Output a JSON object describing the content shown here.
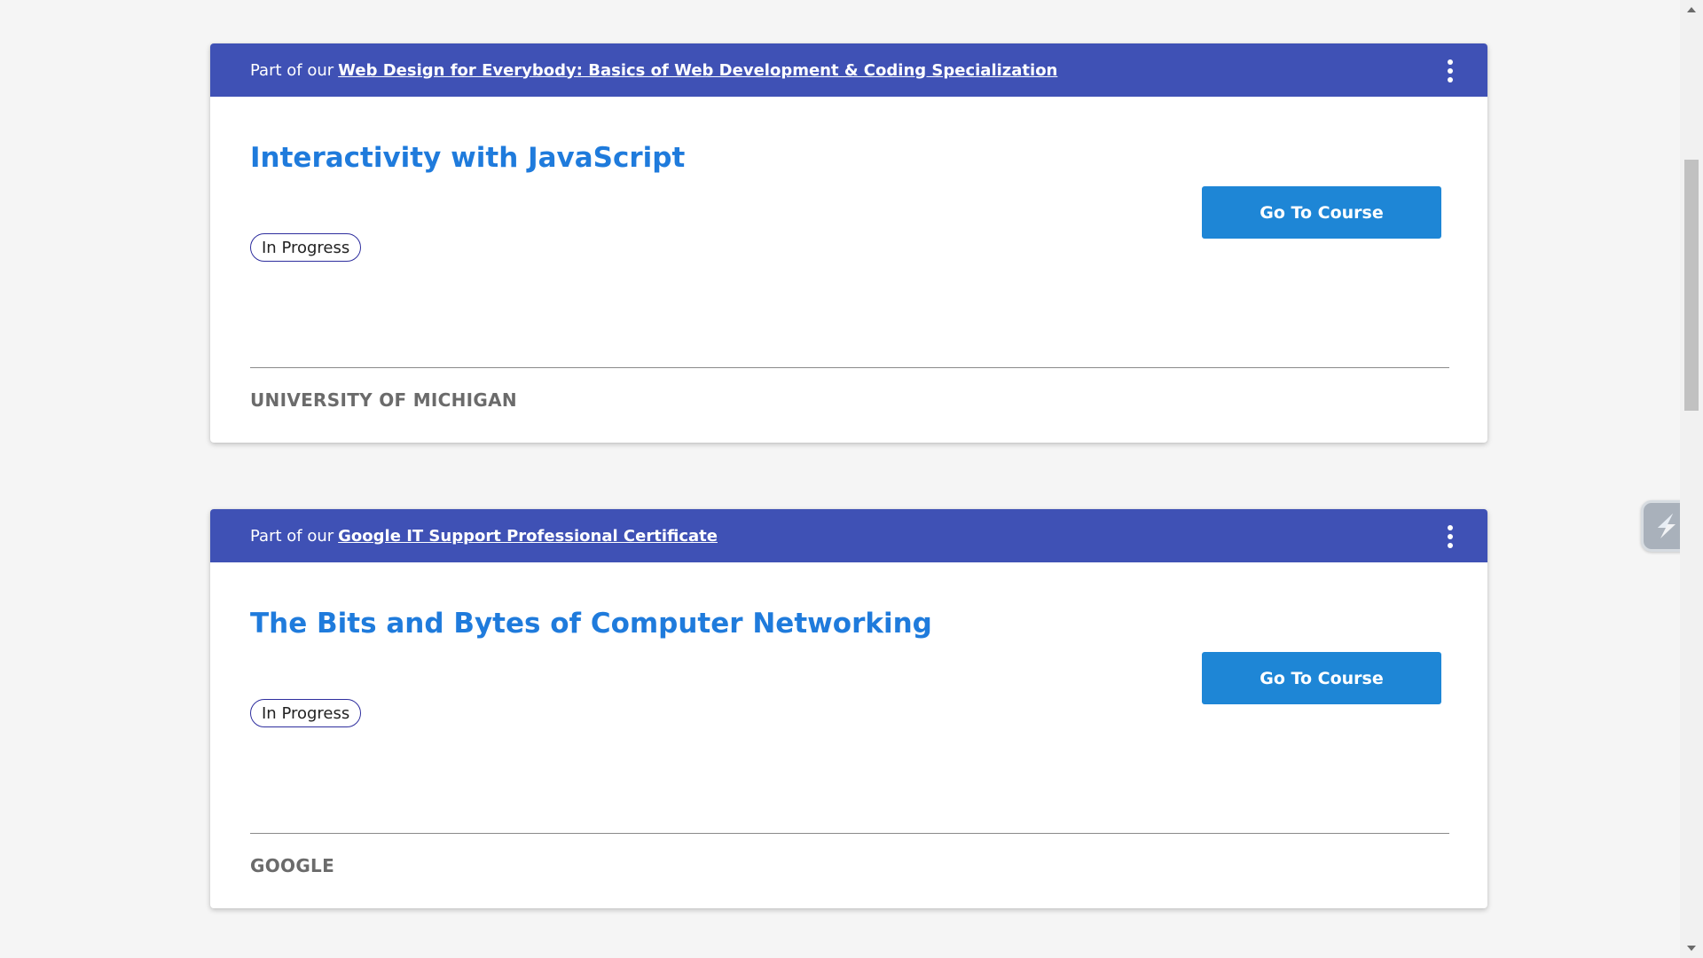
{
  "courses": [
    {
      "header_prefix": "Part of our",
      "header_link": "Web Design for Everybody: Basics of Web Development & Coding Specialization",
      "title": "Interactivity with JavaScript",
      "status": "In Progress",
      "button_label": "Go To Course",
      "partner": "UNIVERSITY OF MICHIGAN"
    },
    {
      "header_prefix": "Part of our",
      "header_link": "Google IT Support Professional Certificate",
      "title": "The Bits and Bytes of Computer Networking",
      "status": "In Progress",
      "button_label": "Go To Course",
      "partner": "GOOGLE"
    }
  ],
  "colors": {
    "header_bg": "#3f51b5",
    "title": "#1f7bdc",
    "button_bg": "#1e86d6",
    "badge_border": "#2e2e9e",
    "partner_text": "#6b6b6b"
  },
  "icons": {
    "more_menu": "kebab-menu-icon",
    "floating_widget": "lightning-extension-icon"
  }
}
